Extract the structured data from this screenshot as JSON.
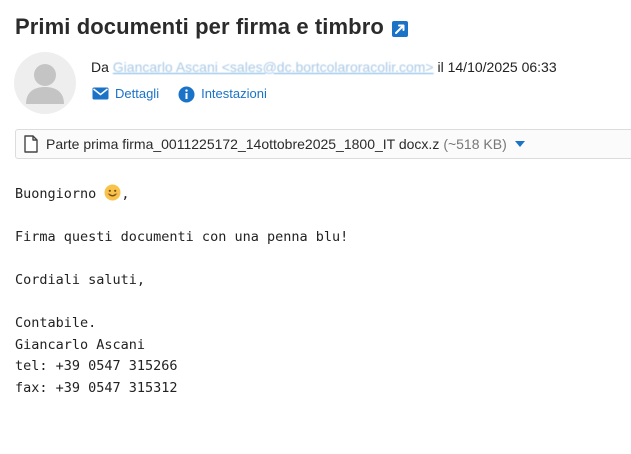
{
  "email": {
    "subject": "Primi documenti per firma e timbro",
    "from_prefix": "Da",
    "sender": "Giancarlo Ascani <sales@dc.bortcolaroracolir.com>",
    "date_text": "il 14/10/2025 06:33"
  },
  "actions": {
    "details_label": "Dettagli",
    "headers_label": "Intestazioni"
  },
  "attachment": {
    "filename": "Parte prima firma_0011225172_14ottobre2025_1800_IT docx.z",
    "size": "(~518 KB)"
  },
  "body": {
    "greeting": "Buongiorno",
    "greeting_end": ",",
    "line1": "Firma questi documenti con una penna blu!",
    "closing": "Cordiali saluti,",
    "sig_role": "Contabile.",
    "sig_name": "Giancarlo Ascani",
    "sig_tel": "tel: +39 0547 315266",
    "sig_fax": "fax: +39 0547 315312"
  },
  "colors": {
    "link": "#1a73c7",
    "subject": "#2b2b2b",
    "emoji": "#f7c34a"
  },
  "icons": {
    "popout": "external-link-icon",
    "avatar": "user-avatar-icon",
    "details": "envelope-icon",
    "headers": "info-icon",
    "file": "document-icon",
    "dropdown": "caret-down-icon",
    "emoji": "smile-emoji-icon"
  }
}
